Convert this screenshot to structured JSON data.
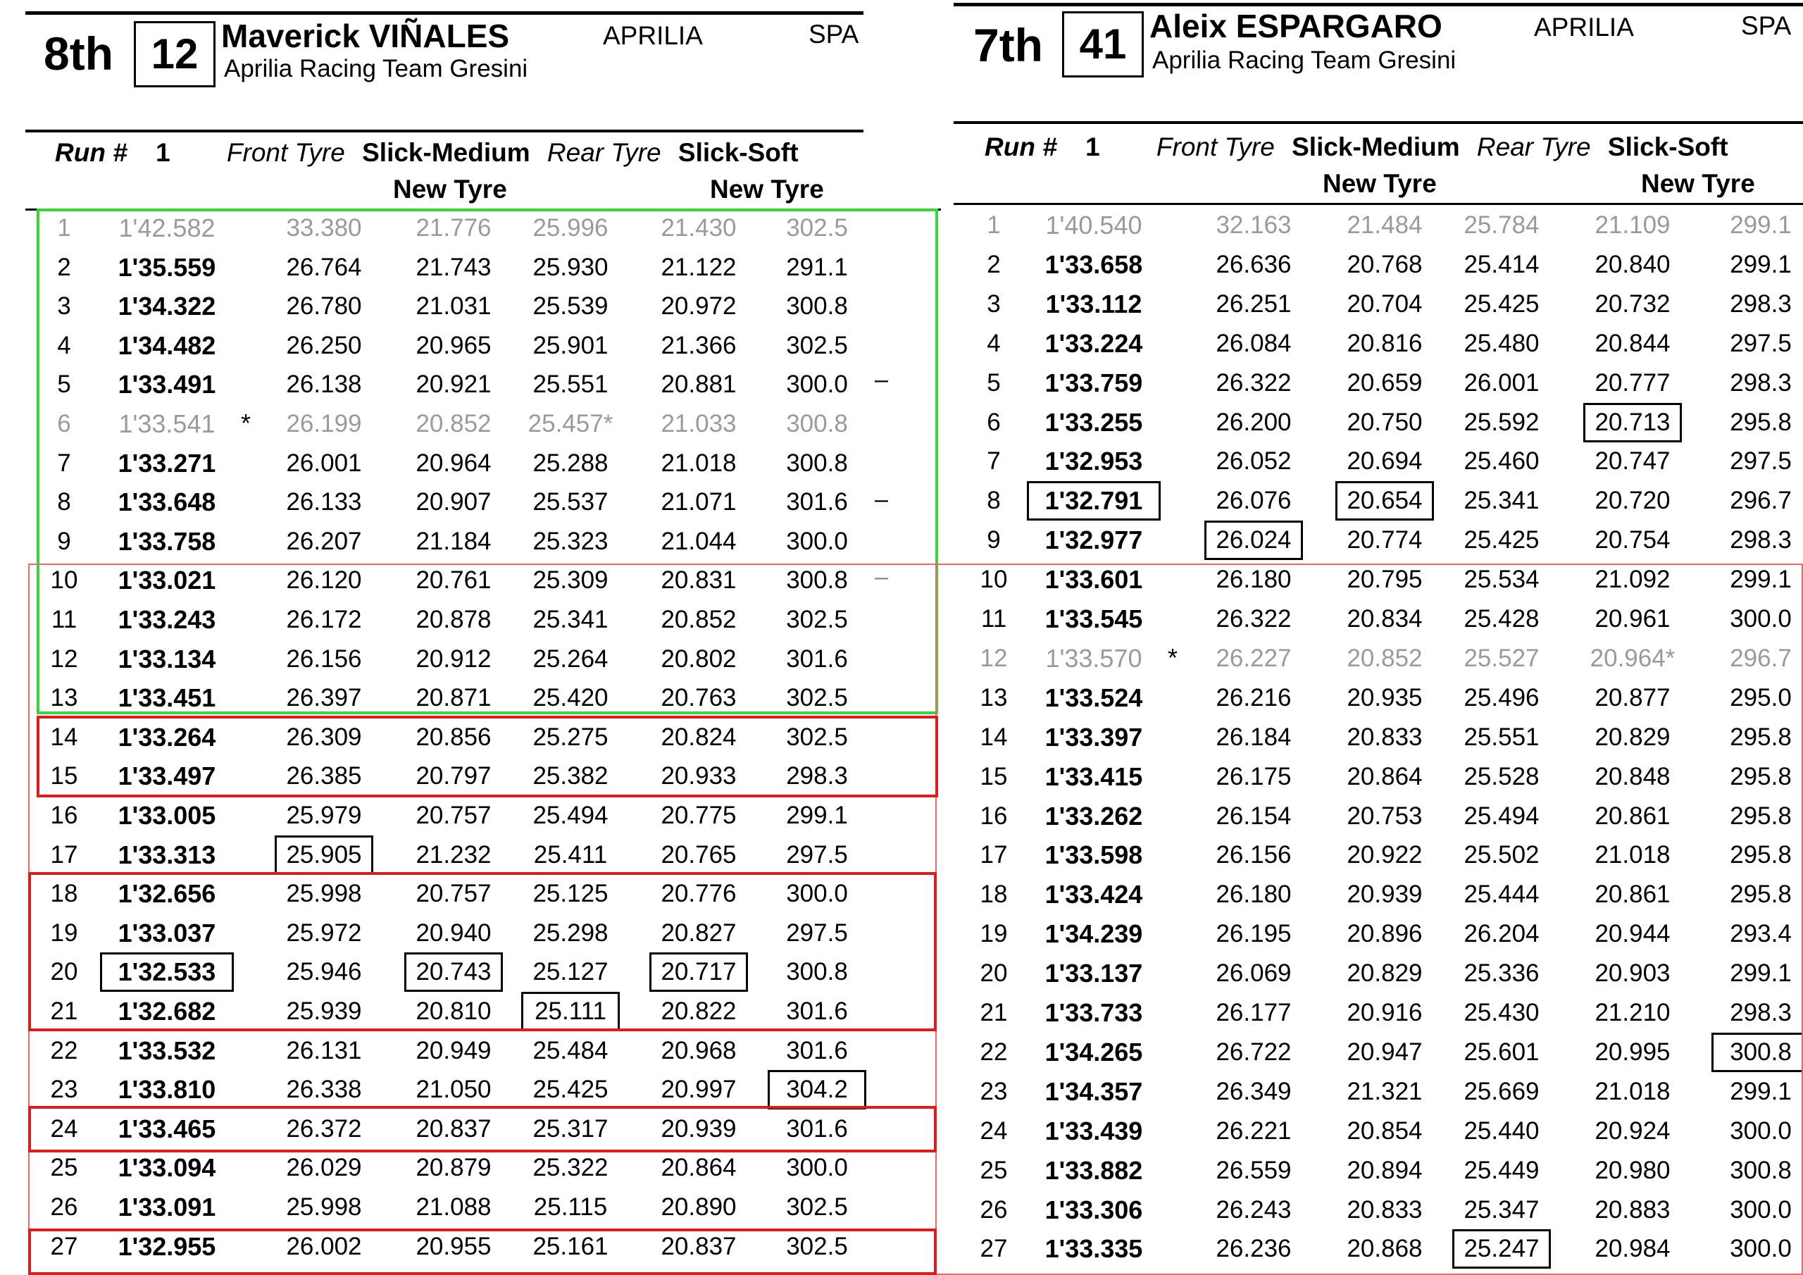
{
  "left": {
    "position": "8th",
    "rider_number": "12",
    "rider_name": "Maverick VIÑALES",
    "team": "Aprilia Racing Team Gresini",
    "manufacturer": "APRILIA",
    "nation": "SPA",
    "run_label": "Run #",
    "run_number": "1",
    "front_tyre_label": "Front Tyre",
    "front_tyre": "Slick-Medium",
    "rear_tyre_label": "Rear Tyre",
    "rear_tyre": "Slick-Soft",
    "front_tyre_condition": "New Tyre",
    "rear_tyre_condition": "New Tyre",
    "laps": [
      {
        "lap": "1",
        "time": "1'42.582",
        "s1": "33.380",
        "s2": "21.776",
        "s3": "25.996",
        "s4": "21.430",
        "speed": "302.5",
        "invalid": true
      },
      {
        "lap": "2",
        "time": "1'35.559",
        "s1": "26.764",
        "s2": "21.743",
        "s3": "25.930",
        "s4": "21.122",
        "speed": "291.1"
      },
      {
        "lap": "3",
        "time": "1'34.322",
        "s1": "26.780",
        "s2": "21.031",
        "s3": "25.539",
        "s4": "20.972",
        "speed": "300.8"
      },
      {
        "lap": "4",
        "time": "1'34.482",
        "s1": "26.250",
        "s2": "20.965",
        "s3": "25.901",
        "s4": "21.366",
        "speed": "302.5"
      },
      {
        "lap": "5",
        "time": "1'33.491",
        "s1": "26.138",
        "s2": "20.921",
        "s3": "25.551",
        "s4": "20.881",
        "speed": "300.0"
      },
      {
        "lap": "6",
        "time": "1'33.541",
        "s1": "26.199",
        "s2": "20.852",
        "s3": "25.457*",
        "s4": "21.033",
        "speed": "300.8",
        "invalid": true,
        "time_mark": "*"
      },
      {
        "lap": "7",
        "time": "1'33.271",
        "s1": "26.001",
        "s2": "20.964",
        "s3": "25.288",
        "s4": "21.018",
        "speed": "300.8"
      },
      {
        "lap": "8",
        "time": "1'33.648",
        "s1": "26.133",
        "s2": "20.907",
        "s3": "25.537",
        "s4": "21.071",
        "speed": "301.6"
      },
      {
        "lap": "9",
        "time": "1'33.758",
        "s1": "26.207",
        "s2": "21.184",
        "s3": "25.323",
        "s4": "21.044",
        "speed": "300.0"
      },
      {
        "lap": "10",
        "time": "1'33.021",
        "s1": "26.120",
        "s2": "20.761",
        "s3": "25.309",
        "s4": "20.831",
        "speed": "300.8"
      },
      {
        "lap": "11",
        "time": "1'33.243",
        "s1": "26.172",
        "s2": "20.878",
        "s3": "25.341",
        "s4": "20.852",
        "speed": "302.5"
      },
      {
        "lap": "12",
        "time": "1'33.134",
        "s1": "26.156",
        "s2": "20.912",
        "s3": "25.264",
        "s4": "20.802",
        "speed": "301.6"
      },
      {
        "lap": "13",
        "time": "1'33.451",
        "s1": "26.397",
        "s2": "20.871",
        "s3": "25.420",
        "s4": "20.763",
        "speed": "302.5"
      },
      {
        "lap": "14",
        "time": "1'33.264",
        "s1": "26.309",
        "s2": "20.856",
        "s3": "25.275",
        "s4": "20.824",
        "speed": "302.5"
      },
      {
        "lap": "15",
        "time": "1'33.497",
        "s1": "26.385",
        "s2": "20.797",
        "s3": "25.382",
        "s4": "20.933",
        "speed": "298.3"
      },
      {
        "lap": "16",
        "time": "1'33.005",
        "s1": "25.979",
        "s2": "20.757",
        "s3": "25.494",
        "s4": "20.775",
        "speed": "299.1"
      },
      {
        "lap": "17",
        "time": "1'33.313",
        "s1": "25.905",
        "s2": "21.232",
        "s3": "25.411",
        "s4": "20.765",
        "speed": "297.5"
      },
      {
        "lap": "18",
        "time": "1'32.656",
        "s1": "25.998",
        "s2": "20.757",
        "s3": "25.125",
        "s4": "20.776",
        "speed": "300.0"
      },
      {
        "lap": "19",
        "time": "1'33.037",
        "s1": "25.972",
        "s2": "20.940",
        "s3": "25.298",
        "s4": "20.827",
        "speed": "297.5"
      },
      {
        "lap": "20",
        "time": "1'32.533",
        "s1": "25.946",
        "s2": "20.743",
        "s3": "25.127",
        "s4": "20.717",
        "speed": "300.8"
      },
      {
        "lap": "21",
        "time": "1'32.682",
        "s1": "25.939",
        "s2": "20.810",
        "s3": "25.111",
        "s4": "20.822",
        "speed": "301.6"
      },
      {
        "lap": "22",
        "time": "1'33.532",
        "s1": "26.131",
        "s2": "20.949",
        "s3": "25.484",
        "s4": "20.968",
        "speed": "301.6"
      },
      {
        "lap": "23",
        "time": "1'33.810",
        "s1": "26.338",
        "s2": "21.050",
        "s3": "25.425",
        "s4": "20.997",
        "speed": "304.2"
      },
      {
        "lap": "24",
        "time": "1'33.465",
        "s1": "26.372",
        "s2": "20.837",
        "s3": "25.317",
        "s4": "20.939",
        "speed": "301.6"
      },
      {
        "lap": "25",
        "time": "1'33.094",
        "s1": "26.029",
        "s2": "20.879",
        "s3": "25.322",
        "s4": "20.864",
        "speed": "300.0"
      },
      {
        "lap": "26",
        "time": "1'33.091",
        "s1": "25.998",
        "s2": "21.088",
        "s3": "25.115",
        "s4": "20.890",
        "speed": "302.5"
      },
      {
        "lap": "27",
        "time": "1'32.955",
        "s1": "26.002",
        "s2": "20.955",
        "s3": "25.161",
        "s4": "20.837",
        "speed": "302.5"
      }
    ]
  },
  "right": {
    "position": "7th",
    "rider_number": "41",
    "rider_name": "Aleix ESPARGARO",
    "team": "Aprilia Racing Team Gresini",
    "manufacturer": "APRILIA",
    "nation": "SPA",
    "run_label": "Run #",
    "run_number": "1",
    "front_tyre_label": "Front Tyre",
    "front_tyre": "Slick-Medium",
    "rear_tyre_label": "Rear Tyre",
    "rear_tyre": "Slick-Soft",
    "front_tyre_condition": "New Tyre",
    "rear_tyre_condition": "New Tyre",
    "laps": [
      {
        "lap": "1",
        "time": "1'40.540",
        "s1": "32.163",
        "s2": "21.484",
        "s3": "25.784",
        "s4": "21.109",
        "speed": "299.1",
        "invalid": true
      },
      {
        "lap": "2",
        "time": "1'33.658",
        "s1": "26.636",
        "s2": "20.768",
        "s3": "25.414",
        "s4": "20.840",
        "speed": "299.1"
      },
      {
        "lap": "3",
        "time": "1'33.112",
        "s1": "26.251",
        "s2": "20.704",
        "s3": "25.425",
        "s4": "20.732",
        "speed": "298.3"
      },
      {
        "lap": "4",
        "time": "1'33.224",
        "s1": "26.084",
        "s2": "20.816",
        "s3": "25.480",
        "s4": "20.844",
        "speed": "297.5"
      },
      {
        "lap": "5",
        "time": "1'33.759",
        "s1": "26.322",
        "s2": "20.659",
        "s3": "26.001",
        "s4": "20.777",
        "speed": "298.3"
      },
      {
        "lap": "6",
        "time": "1'33.255",
        "s1": "26.200",
        "s2": "20.750",
        "s3": "25.592",
        "s4": "20.713",
        "speed": "295.8"
      },
      {
        "lap": "7",
        "time": "1'32.953",
        "s1": "26.052",
        "s2": "20.694",
        "s3": "25.460",
        "s4": "20.747",
        "speed": "297.5"
      },
      {
        "lap": "8",
        "time": "1'32.791",
        "s1": "26.076",
        "s2": "20.654",
        "s3": "25.341",
        "s4": "20.720",
        "speed": "296.7"
      },
      {
        "lap": "9",
        "time": "1'32.977",
        "s1": "26.024",
        "s2": "20.774",
        "s3": "25.425",
        "s4": "20.754",
        "speed": "298.3"
      },
      {
        "lap": "10",
        "time": "1'33.601",
        "s1": "26.180",
        "s2": "20.795",
        "s3": "25.534",
        "s4": "21.092",
        "speed": "299.1"
      },
      {
        "lap": "11",
        "time": "1'33.545",
        "s1": "26.322",
        "s2": "20.834",
        "s3": "25.428",
        "s4": "20.961",
        "speed": "300.0"
      },
      {
        "lap": "12",
        "time": "1'33.570",
        "s1": "26.227",
        "s2": "20.852",
        "s3": "25.527",
        "s4": "20.964*",
        "speed": "296.7",
        "invalid": true,
        "time_mark": "*"
      },
      {
        "lap": "13",
        "time": "1'33.524",
        "s1": "26.216",
        "s2": "20.935",
        "s3": "25.496",
        "s4": "20.877",
        "speed": "295.0"
      },
      {
        "lap": "14",
        "time": "1'33.397",
        "s1": "26.184",
        "s2": "20.833",
        "s3": "25.551",
        "s4": "20.829",
        "speed": "295.8"
      },
      {
        "lap": "15",
        "time": "1'33.415",
        "s1": "26.175",
        "s2": "20.864",
        "s3": "25.528",
        "s4": "20.848",
        "speed": "295.8"
      },
      {
        "lap": "16",
        "time": "1'33.262",
        "s1": "26.154",
        "s2": "20.753",
        "s3": "25.494",
        "s4": "20.861",
        "speed": "295.8"
      },
      {
        "lap": "17",
        "time": "1'33.598",
        "s1": "26.156",
        "s2": "20.922",
        "s3": "25.502",
        "s4": "21.018",
        "speed": "295.8"
      },
      {
        "lap": "18",
        "time": "1'33.424",
        "s1": "26.180",
        "s2": "20.939",
        "s3": "25.444",
        "s4": "20.861",
        "speed": "295.8"
      },
      {
        "lap": "19",
        "time": "1'34.239",
        "s1": "26.195",
        "s2": "20.896",
        "s3": "26.204",
        "s4": "20.944",
        "speed": "293.4"
      },
      {
        "lap": "20",
        "time": "1'33.137",
        "s1": "26.069",
        "s2": "20.829",
        "s3": "25.336",
        "s4": "20.903",
        "speed": "299.1"
      },
      {
        "lap": "21",
        "time": "1'33.733",
        "s1": "26.177",
        "s2": "20.916",
        "s3": "25.430",
        "s4": "21.210",
        "speed": "298.3"
      },
      {
        "lap": "22",
        "time": "1'34.265",
        "s1": "26.722",
        "s2": "20.947",
        "s3": "25.601",
        "s4": "20.995",
        "speed": "300.8"
      },
      {
        "lap": "23",
        "time": "1'34.357",
        "s1": "26.349",
        "s2": "21.321",
        "s3": "25.669",
        "s4": "21.018",
        "speed": "299.1"
      },
      {
        "lap": "24",
        "time": "1'33.439",
        "s1": "26.221",
        "s2": "20.854",
        "s3": "25.440",
        "s4": "20.924",
        "speed": "300.0"
      },
      {
        "lap": "25",
        "time": "1'33.882",
        "s1": "26.559",
        "s2": "20.894",
        "s3": "25.449",
        "s4": "20.980",
        "speed": "300.8"
      },
      {
        "lap": "26",
        "time": "1'33.306",
        "s1": "26.243",
        "s2": "20.833",
        "s3": "25.347",
        "s4": "20.883",
        "speed": "300.0"
      },
      {
        "lap": "27",
        "time": "1'33.335",
        "s1": "26.236",
        "s2": "20.868",
        "s3": "25.247",
        "s4": "20.984",
        "speed": "300.0"
      }
    ]
  },
  "colors": {
    "highlight_green": "#39d43a",
    "highlight_red": "#e21a1a",
    "invalid_grey": "#9a9a9a"
  }
}
